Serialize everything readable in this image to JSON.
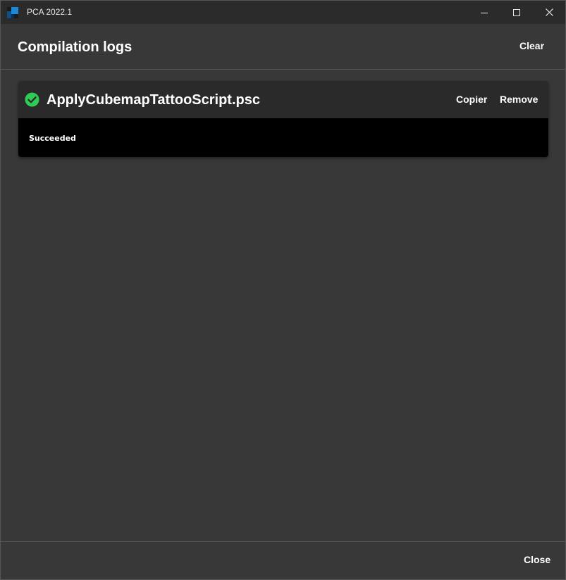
{
  "window": {
    "title": "PCA 2022.1",
    "icons": {
      "app": "app-logo-icon",
      "minimize": "minimize-icon",
      "maximize": "maximize-icon",
      "close": "close-icon"
    }
  },
  "header": {
    "title": "Compilation logs",
    "clear_label": "Clear"
  },
  "logs": [
    {
      "status": "success",
      "status_icon": "check-circle-icon",
      "status_color": "#2ecc54",
      "script_name": "ApplyCubemapTattooScript.psc",
      "copy_label": "Copier",
      "remove_label": "Remove",
      "output": "Succeeded"
    }
  ],
  "footer": {
    "close_label": "Close"
  },
  "colors": {
    "window_bg": "#383838",
    "titlebar_bg": "#2b2b2b",
    "card_head_bg": "#2a2a2a",
    "card_body_bg": "#000000",
    "app_icon_blue": "#1e88d6"
  }
}
